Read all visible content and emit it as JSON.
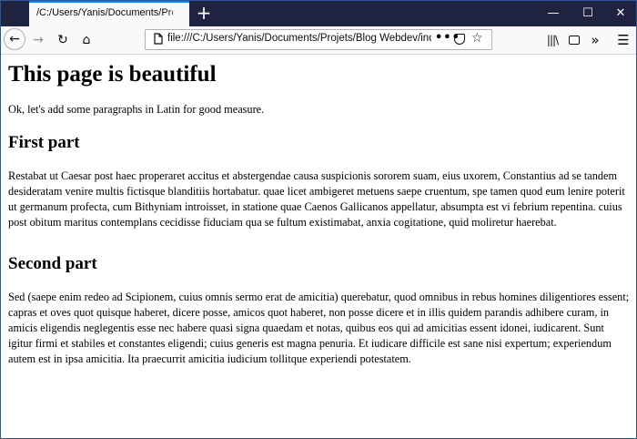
{
  "browser": {
    "tab": {
      "title": "/C:/Users/Yanis/Documents/Projets/Blog Webdev/index.html"
    },
    "new_tab_label": "+",
    "window_controls": {
      "minimize": "—",
      "maximize": "☐",
      "close": "✕"
    },
    "toolbar": {
      "back": "←",
      "forward": "→",
      "reload": "↻",
      "home": "⌂",
      "url": "file:///C:/Users/Yanis/Documents/Projets/Blog Webdev/index.html",
      "page_actions": "•••",
      "star": "☆",
      "library": "|||\\",
      "overflow": "»",
      "menu": "☰"
    }
  },
  "page": {
    "title": "This page is beautiful",
    "intro": "Ok, let's add some paragraphs in Latin for good measure.",
    "sections": [
      {
        "heading": "First part",
        "text": "Restabat ut Caesar post haec properaret accitus et abstergendae causa suspicionis sororem suam, eius uxorem, Constantius ad se tandem desideratam venire multis fictisque blanditiis hortabatur. quae licet ambigeret metuens saepe cruentum, spe tamen quod eum lenire poterit ut germanum profecta, cum Bithyniam introisset, in statione quae Caenos Gallicanos appellatur, absumpta est vi febrium repentina. cuius post obitum maritus contemplans cecidisse fiduciam qua se fultum existimabat, anxia cogitatione, quid moliretur haerebat."
      },
      {
        "heading": "Second part",
        "text": "Sed (saepe enim redeo ad Scipionem, cuius omnis sermo erat de amicitia) querebatur, quod omnibus in rebus homines diligentiores essent; capras et oves quot quisque haberet, dicere posse, amicos quot haberet, non posse dicere et in illis quidem parandis adhibere curam, in amicis eligendis neglegentis esse nec habere quasi signa quaedam et notas, quibus eos qui ad amicitias essent idonei, iudicarent. Sunt igitur firmi et stabiles et constantes eligendi; cuius generis est magna penuria. Et iudicare difficile est sane nisi expertum; experiendum autem est in ipsa amicitia. Ita praecurrit amicitia iudicium tollitque experiendi potestatem."
      }
    ]
  }
}
